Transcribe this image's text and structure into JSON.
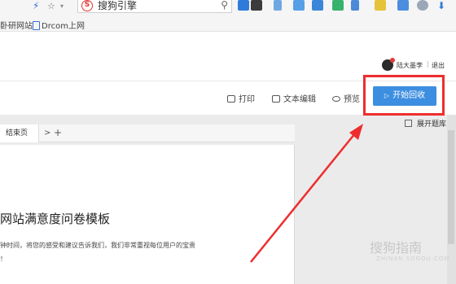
{
  "browser": {
    "search_value": "搜狗引擎"
  },
  "bookmarks": [
    {
      "label": "卧研网站"
    },
    {
      "label": "Drcom上网"
    }
  ],
  "header": {
    "username": "陆大墨李",
    "separator": "|",
    "logout": "退出"
  },
  "actions": {
    "print": "打印",
    "text_edit": "文本编辑",
    "preview": "预览",
    "start_recycle": "开始回收"
  },
  "panel": {
    "expand_library": "展开题库"
  },
  "tabs": {
    "end_page": "结束页",
    "next": ">",
    "add": "+"
  },
  "page": {
    "title": "网站满意度问卷模板",
    "desc_line1": "钟时间，将您的感受和建议告诉我们，我们非常重视每位用户的宝贵",
    "desc_line2": "！"
  },
  "watermark": {
    "main": "搜狗指南",
    "sub": "ZHINAN.SOGOU.COM"
  },
  "colors": {
    "accent": "#3c8ee0",
    "highlight": "#ee2d2d"
  }
}
